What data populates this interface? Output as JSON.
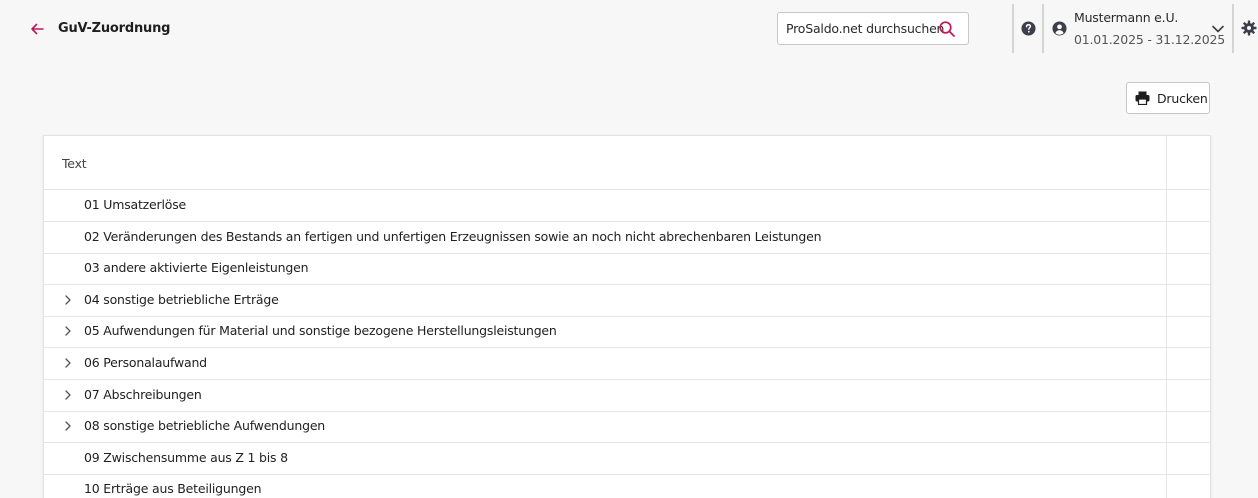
{
  "header": {
    "title": "GuV-Zuordnung",
    "search_placeholder": "ProSaldo.net durchsuchen",
    "company": "Mustermann e.U.",
    "period": "01.01.2025 - 31.12.2025"
  },
  "toolbar": {
    "print_label": "Drucken"
  },
  "table": {
    "column_header": "Text",
    "rows": [
      {
        "label": "01 Umsatzerlöse",
        "expandable": false
      },
      {
        "label": "02 Veränderungen des Bestands an fertigen und unfertigen Erzeugnissen sowie an noch nicht abrechenbaren Leistungen",
        "expandable": false
      },
      {
        "label": "03 andere aktivierte Eigenleistungen",
        "expandable": false
      },
      {
        "label": "04 sonstige betriebliche Erträge",
        "expandable": true
      },
      {
        "label": "05 Aufwendungen für Material und sonstige bezogene Herstellungsleistungen",
        "expandable": true
      },
      {
        "label": "06 Personalaufwand",
        "expandable": true
      },
      {
        "label": "07 Abschreibungen",
        "expandable": true
      },
      {
        "label": "08 sonstige betriebliche Aufwendungen",
        "expandable": true
      },
      {
        "label": "09 Zwischensumme aus Z 1 bis 8",
        "expandable": false
      },
      {
        "label": "10 Erträge aus Beteiligungen",
        "expandable": false
      }
    ]
  },
  "colors": {
    "accent": "#c2185b",
    "icon_dark": "#3a3f4b",
    "background": "#f7f7f7"
  },
  "icons": {
    "back": "arrow-left-icon",
    "search": "search-icon",
    "help": "question-circle-icon",
    "user": "user-circle-icon",
    "dropdown": "chevron-down-icon",
    "settings": "gear-icon",
    "print": "printer-icon",
    "expand": "chevron-right-icon"
  }
}
